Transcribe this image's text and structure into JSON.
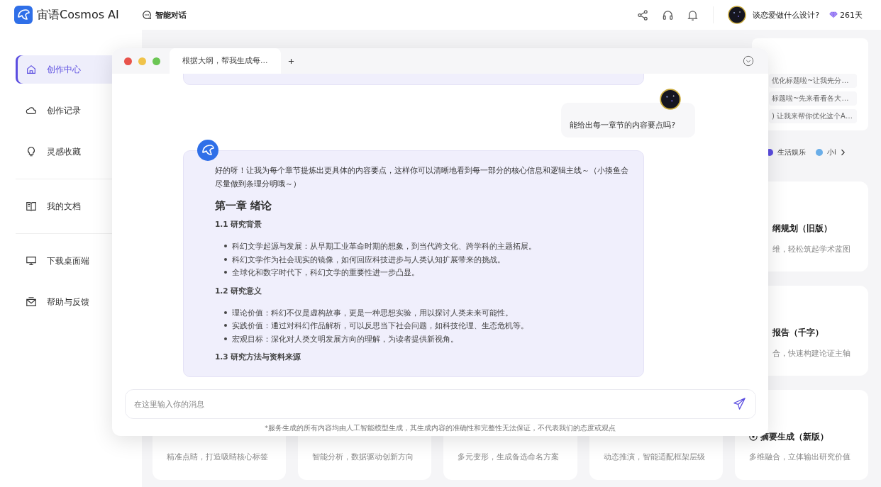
{
  "header": {
    "brand": "宙语Cosmos AI",
    "nav": {
      "label": "智能对话"
    },
    "user": {
      "name": "谈恋爱做什么设计?"
    },
    "days": "261天"
  },
  "sidebar": {
    "sections": [
      [
        {
          "label": "创作中心",
          "selected": true
        },
        {
          "label": "创作记录",
          "selected": false
        },
        {
          "label": "灵感收藏",
          "selected": false
        }
      ],
      [
        {
          "label": "我的文档",
          "selected": false
        }
      ],
      [
        {
          "label": "下载桌面端",
          "selected": false
        },
        {
          "label": "帮助与反馈",
          "selected": false
        }
      ]
    ]
  },
  "history": [
    "优化标题啦~让我先分…",
    "标题啦~先来看看各大…",
    ") 让我来帮你优化这个A…"
  ],
  "tags": [
    {
      "label": "生活娱乐",
      "color": "#5b4de0"
    },
    {
      "label": "小i",
      "color": "#6aaee8"
    }
  ],
  "side_cards": [
    {
      "title": "纲规划（旧版）",
      "desc": "维，轻松筑起学术蓝图"
    },
    {
      "title": "报告（千字）",
      "desc": "合，快速构建论证主轴"
    }
  ],
  "bottom_cards": [
    {
      "desc": "精准点睛，打造吸睛核心标签"
    },
    {
      "desc": "智能分析，数据驱动创新方向"
    },
    {
      "desc": "多元变形，生成备选命名方案"
    },
    {
      "desc": "动态推演，智能适配框架层级"
    },
    {
      "title": "摘要生成（新版）",
      "desc": "多维融合，立体输出研究价值"
    }
  ],
  "chat": {
    "tab": "根据大纲，帮我生成每…",
    "user_message": "能给出每一章节的内容要点吗?",
    "reply": {
      "intro": "好的呀！让我为每个章节提炼出更具体的内容要点，这样你可以清晰地看到每一部分的核心信息和逻辑主线～（小揍鱼会尽量做到条理分明哦～）",
      "heading": "第一章 绪论",
      "sections": [
        {
          "title": "1.1 研究背景",
          "bullets": [
            "科幻文学起源与发展：从早期工业革命时期的想象，到当代跨文化、跨学科的主题拓展。",
            "科幻文学作为社会现实的镜像，如何回应科技进步与人类认知扩展带来的挑战。",
            "全球化和数字时代下，科幻文学的重要性进一步凸显。"
          ]
        },
        {
          "title": "1.2 研究意义",
          "bullets": [
            "理论价值：科幻不仅是虚构故事，更是一种思想实验，用以探讨人类未来可能性。",
            "实践价值：通过对科幻作品解析，可以反思当下社会问题，如科技伦理、生态危机等。",
            "宏观目标：深化对人类文明发展方向的理解，为读者提供新视角。"
          ]
        },
        {
          "title": "1.3 研究方法与资料来源"
        }
      ]
    },
    "input": {
      "placeholder": "在这里输入你的消息"
    },
    "disclaimer": "*服务生成的所有内容均由人工智能模型生成，其生成内容的准确性和完整性无法保证，不代表我们的态度或观点"
  }
}
